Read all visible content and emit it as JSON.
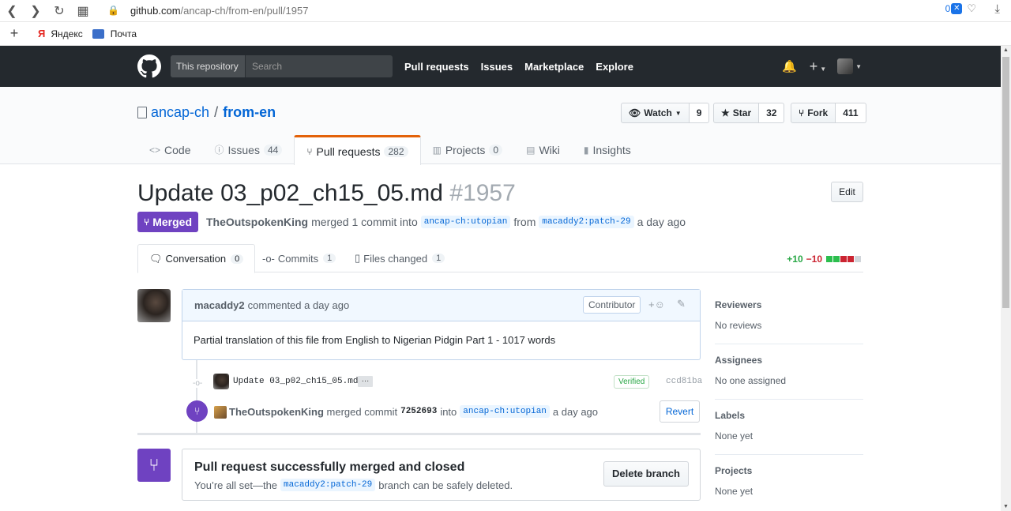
{
  "browser": {
    "url_domain": "github.com",
    "url_path": "/ancap-ch/from-en/pull/1957",
    "badge_count": "0",
    "bookmarks": [
      {
        "label": "Яндекс"
      },
      {
        "label": "Почта"
      }
    ]
  },
  "header": {
    "search_scope": "This repository",
    "search_placeholder": "Search",
    "nav": [
      "Pull requests",
      "Issues",
      "Marketplace",
      "Explore"
    ]
  },
  "repo": {
    "owner": "ancap-ch",
    "separator": "/",
    "name": "from-en",
    "watch_label": "Watch",
    "watch_count": "9",
    "star_label": "Star",
    "star_count": "32",
    "fork_label": "Fork",
    "fork_count": "411",
    "tabs": [
      {
        "label": "Code",
        "count": ""
      },
      {
        "label": "Issues",
        "count": "44"
      },
      {
        "label": "Pull requests",
        "count": "282"
      },
      {
        "label": "Projects",
        "count": "0"
      },
      {
        "label": "Wiki",
        "count": ""
      },
      {
        "label": "Insights",
        "count": ""
      }
    ]
  },
  "pr": {
    "title": "Update 03_p02_ch15_05.md",
    "number": "#1957",
    "edit_label": "Edit",
    "state": "Merged",
    "author": "TheOutspokenKing",
    "merged_text": "merged 1 commit into",
    "base_ref": "ancap-ch:utopian",
    "from_text": "from",
    "head_ref": "macaddy2:patch-29",
    "time": "a day ago",
    "tabs": [
      {
        "label": "Conversation",
        "count": "0"
      },
      {
        "label": "Commits",
        "count": "1"
      },
      {
        "label": "Files changed",
        "count": "1"
      }
    ],
    "additions": "+10",
    "deletions": "−10",
    "diff_colors": [
      "#2cbe4e",
      "#2cbe4e",
      "#cb2431",
      "#cb2431",
      "#d1d5da"
    ]
  },
  "comment": {
    "author": "macaddy2",
    "action": "commented a day ago",
    "role": "Contributor",
    "body": "Partial translation of this file from English to Nigerian Pidgin Part 1 - 1017 words"
  },
  "commit": {
    "message": "Update 03_p02_ch15_05.md",
    "toggle": "…",
    "verified": "Verified",
    "sha": "ccd81ba"
  },
  "merge_event": {
    "actor": "TheOutspokenKing",
    "text": "merged commit",
    "sha": "7252693",
    "into": "into",
    "ref": "ancap-ch:utopian",
    "time": "a day ago",
    "revert_label": "Revert"
  },
  "merged_box": {
    "title": "Pull request successfully merged and closed",
    "sub_prefix": "You’re all set—the",
    "ref": "macaddy2:patch-29",
    "sub_suffix": "branch can be safely deleted.",
    "delete_label": "Delete branch"
  },
  "sidebar": [
    {
      "heading": "Reviewers",
      "value": "No reviews"
    },
    {
      "heading": "Assignees",
      "value": "No one assigned"
    },
    {
      "heading": "Labels",
      "value": "None yet"
    },
    {
      "heading": "Projects",
      "value": "None yet"
    }
  ]
}
